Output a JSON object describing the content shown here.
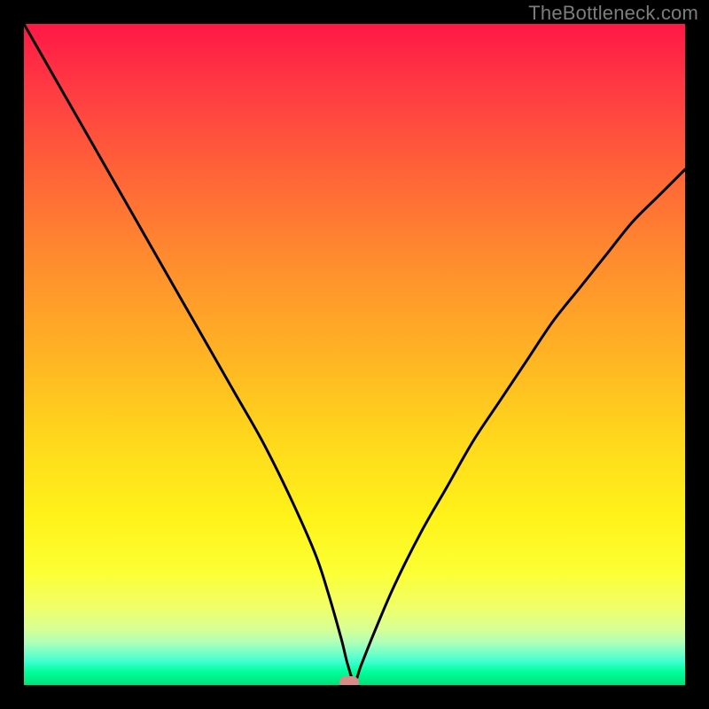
{
  "watermark": "TheBottleneck.com",
  "chart_data": {
    "type": "line",
    "title": "",
    "xlabel": "",
    "ylabel": "",
    "xlim": [
      0,
      100
    ],
    "ylim": [
      0,
      100
    ],
    "grid": false,
    "legend": false,
    "background_gradient": {
      "top": "#ff1846",
      "upper_mid": "#ffb324",
      "lower_mid": "#fff31a",
      "bottom": "#00e07a"
    },
    "x": [
      0,
      4,
      8,
      12,
      16,
      20,
      24,
      28,
      32,
      36,
      40,
      44,
      46,
      48,
      49,
      50,
      51,
      53,
      56,
      60,
      64,
      68,
      72,
      76,
      80,
      84,
      88,
      92,
      96,
      100
    ],
    "y": [
      100,
      93,
      86,
      79,
      72,
      65,
      58,
      51,
      44,
      37,
      29,
      20,
      14,
      7,
      3,
      0.5,
      3,
      8,
      15,
      23,
      30,
      37,
      43,
      49,
      55,
      60,
      65,
      70,
      74,
      78
    ],
    "marker": {
      "x": 49.2,
      "y": 0.4
    }
  }
}
